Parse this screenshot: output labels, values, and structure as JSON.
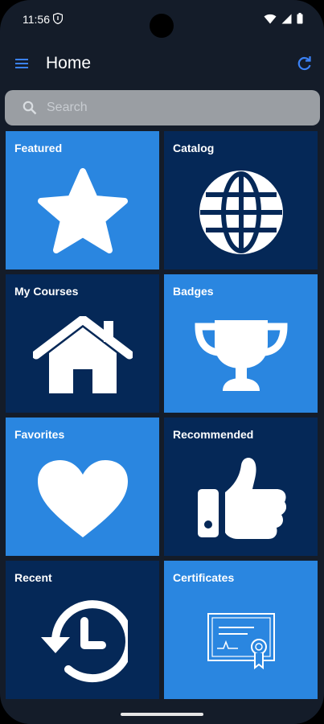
{
  "status": {
    "time": "11:56"
  },
  "app": {
    "title": "Home"
  },
  "search": {
    "placeholder": "Search"
  },
  "tiles": [
    {
      "label": "Featured",
      "icon": "star-icon",
      "theme": "light"
    },
    {
      "label": "Catalog",
      "icon": "globe-icon",
      "theme": "dark"
    },
    {
      "label": "My Courses",
      "icon": "home-icon",
      "theme": "dark"
    },
    {
      "label": "Badges",
      "icon": "trophy-icon",
      "theme": "light"
    },
    {
      "label": "Favorites",
      "icon": "heart-icon",
      "theme": "light"
    },
    {
      "label": "Recommended",
      "icon": "thumbs-up-icon",
      "theme": "dark"
    },
    {
      "label": "Recent",
      "icon": "history-icon",
      "theme": "dark"
    },
    {
      "label": "Certificates",
      "icon": "certificate-icon",
      "theme": "light"
    }
  ],
  "colors": {
    "tile_light": "#2a86e0",
    "tile_dark": "#052857",
    "background": "#141c29",
    "accent": "#3b82f6"
  }
}
